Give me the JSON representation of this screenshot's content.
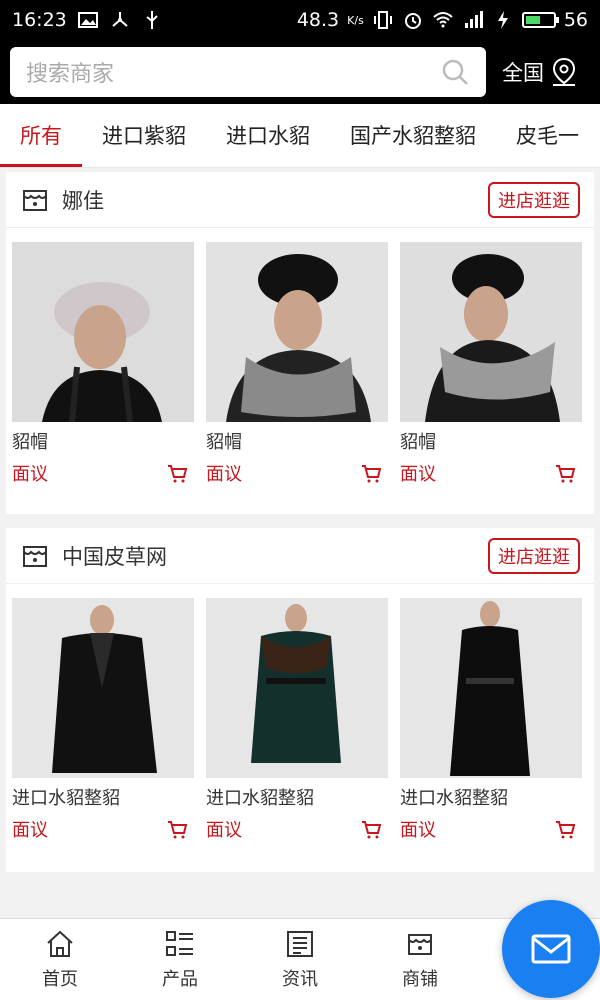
{
  "status_bar": {
    "time": "16:23",
    "speed": "48.3",
    "speed_unit": "K/s",
    "battery": "56",
    "battery_level": 0.56
  },
  "header": {
    "search_placeholder": "搜索商家",
    "region_label": "全国"
  },
  "tabs": [
    {
      "label": "所有",
      "active": true
    },
    {
      "label": "进口紫貂",
      "active": false
    },
    {
      "label": "进口水貂",
      "active": false
    },
    {
      "label": "国产水貂整貂",
      "active": false
    },
    {
      "label": "皮毛一",
      "active": false
    }
  ],
  "shops": [
    {
      "name": "娜佳",
      "visit_label": "进店逛逛",
      "products": [
        {
          "name": "貂帽",
          "price": "面议"
        },
        {
          "name": "貂帽",
          "price": "面议"
        },
        {
          "name": "貂帽",
          "price": "面议"
        }
      ]
    },
    {
      "name": "中国皮草网",
      "visit_label": "进店逛逛",
      "products": [
        {
          "name": "进口水貂整貂",
          "price": "面议"
        },
        {
          "name": "进口水貂整貂",
          "price": "面议"
        },
        {
          "name": "进口水貂整貂",
          "price": "面议"
        }
      ]
    }
  ],
  "bottom_nav": [
    {
      "label": "首页",
      "icon": "home-icon"
    },
    {
      "label": "产品",
      "icon": "list-icon"
    },
    {
      "label": "资讯",
      "icon": "news-icon"
    },
    {
      "label": "商铺",
      "icon": "store-icon"
    }
  ],
  "fab_icon": "mail-icon",
  "colors": {
    "accent": "#c8161d",
    "fab": "#1a7ff0"
  }
}
